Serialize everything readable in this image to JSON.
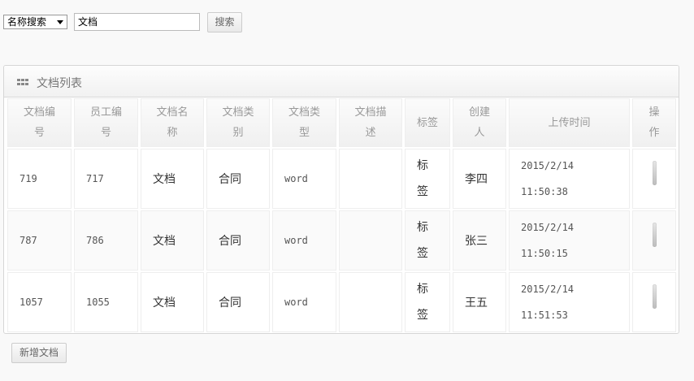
{
  "search": {
    "select_value": "名称搜索",
    "input_value": "文档",
    "button_label": "搜索"
  },
  "panel": {
    "title": "文档列表"
  },
  "table": {
    "headers": [
      [
        "文档编",
        "号"
      ],
      [
        "员工编",
        "号"
      ],
      [
        "文档名",
        "称"
      ],
      [
        "文档类",
        "别"
      ],
      [
        "文档类",
        "型"
      ],
      [
        "文档描",
        "述"
      ],
      [
        "标签"
      ],
      [
        "创建",
        "人"
      ],
      [
        "上传时间"
      ],
      [
        "操",
        "作"
      ]
    ],
    "rows": [
      {
        "doc_id": "719",
        "emp_id": "717",
        "name": "文档",
        "category": "合同",
        "type": "word",
        "desc": "",
        "tag": [
          "标",
          "签"
        ],
        "creator": "李四",
        "date": "2015/2/14",
        "time": "11:50:38"
      },
      {
        "doc_id": "787",
        "emp_id": "786",
        "name": "文档",
        "category": "合同",
        "type": "word",
        "desc": "",
        "tag": [
          "标",
          "签"
        ],
        "creator": "张三",
        "date": "2015/2/14",
        "time": "11:50:15"
      },
      {
        "doc_id": "1057",
        "emp_id": "1055",
        "name": "文档",
        "category": "合同",
        "type": "word",
        "desc": "",
        "tag": [
          "标",
          "签"
        ],
        "creator": "王五",
        "date": "2015/2/14",
        "time": "11:51:53"
      }
    ]
  },
  "footer": {
    "add_button_label": "新增文档"
  },
  "icons": {
    "panel_icon": "grid-icon",
    "select_icon": "caret-down-icon"
  }
}
